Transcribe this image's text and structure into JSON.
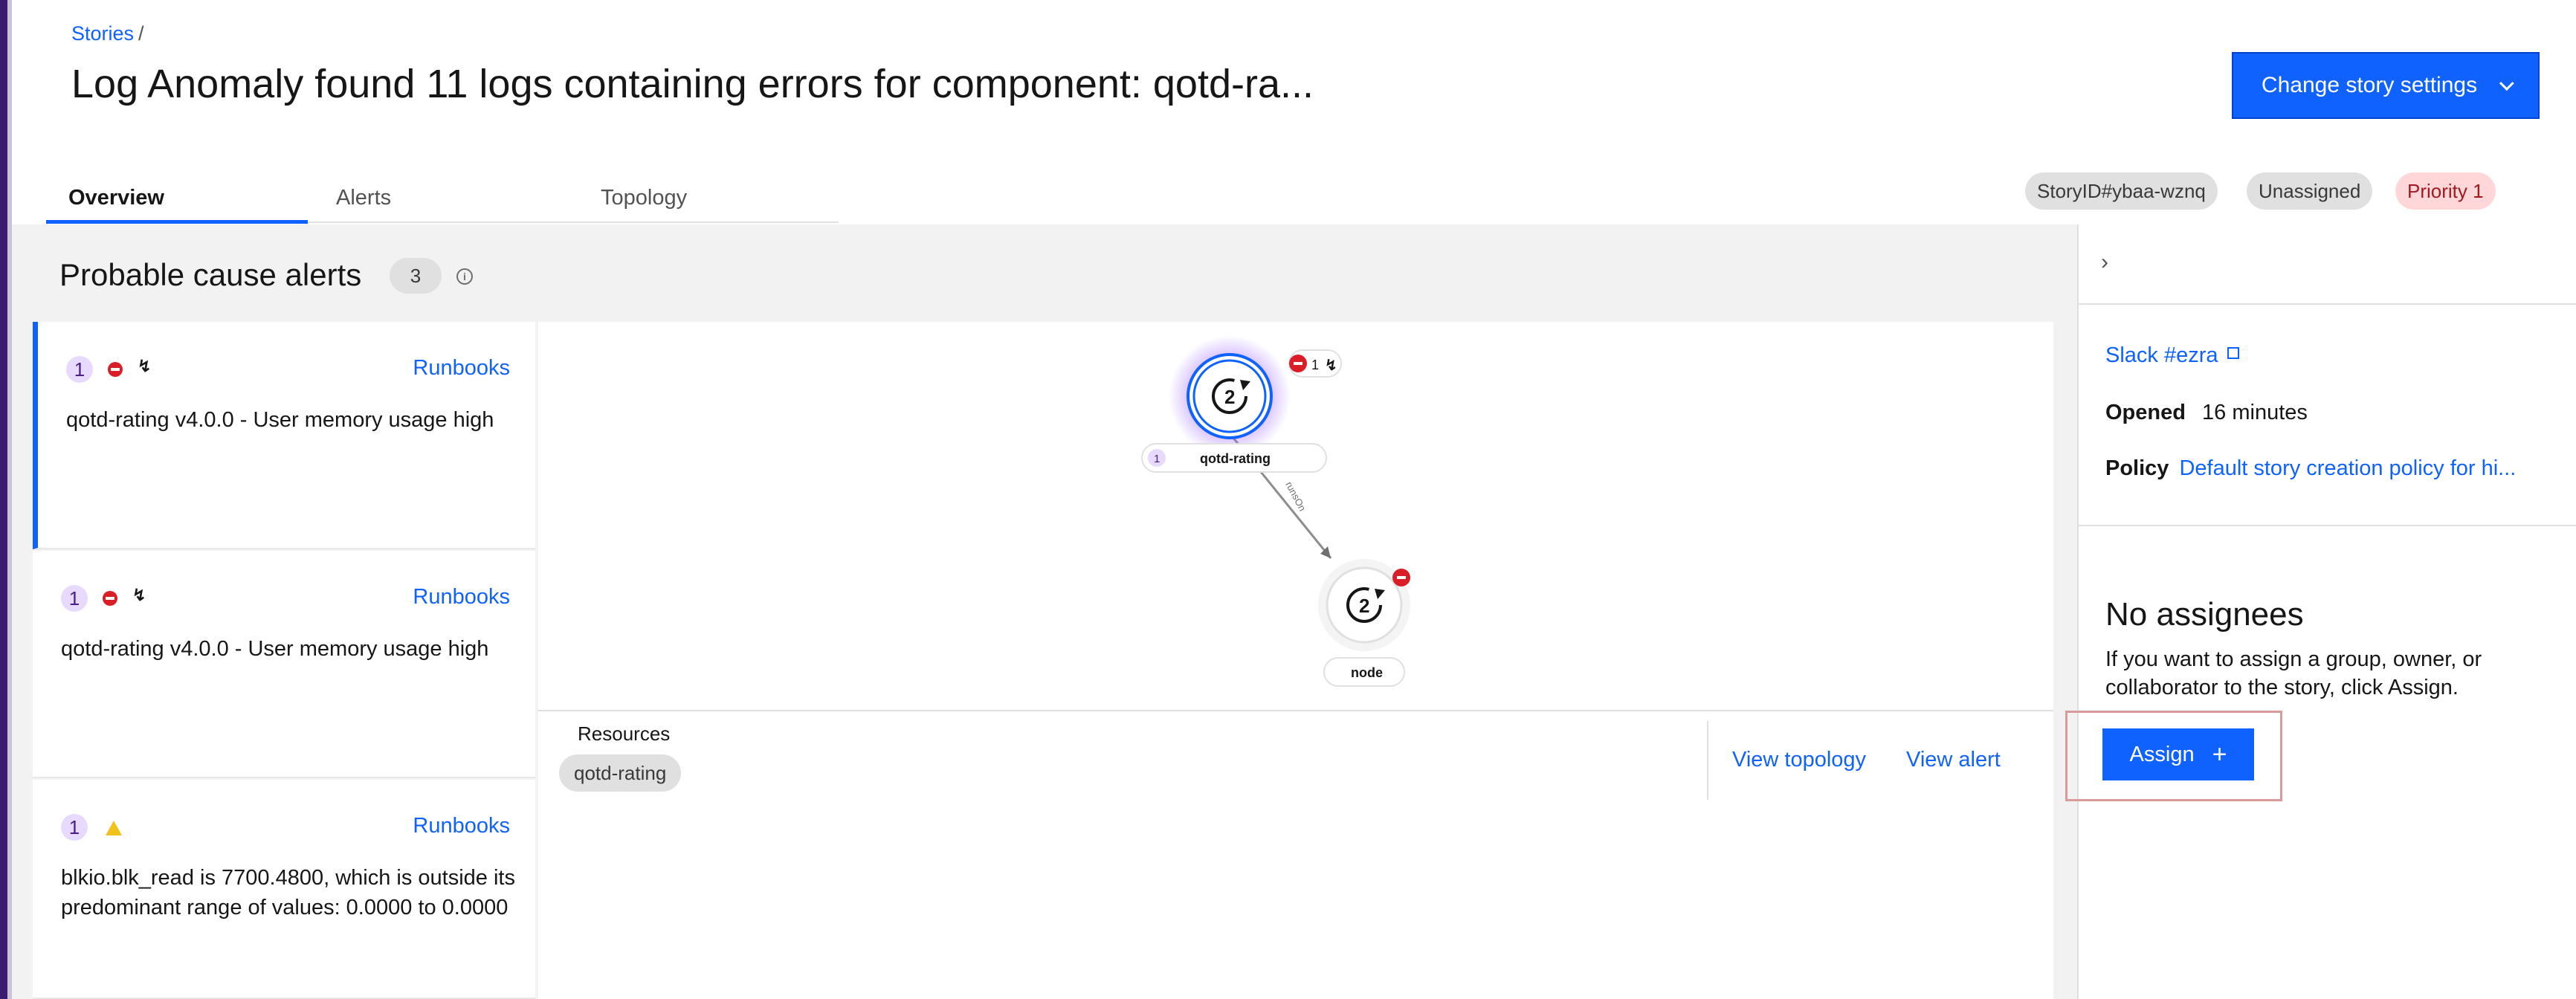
{
  "header": {
    "breadcrumb": "Stories",
    "breadcrumb_sep": "/",
    "title": "Log Anomaly found 11 logs containing errors for component: qotd-ra...",
    "change_settings_label": "Change story settings"
  },
  "tabs": [
    {
      "label": "Overview",
      "active": true
    },
    {
      "label": "Alerts",
      "active": false
    },
    {
      "label": "Topology",
      "active": false
    }
  ],
  "tags": {
    "story_id": "StoryID#ybaa-wznq",
    "assignment": "Unassigned",
    "priority": "Priority 1"
  },
  "probable_cause": {
    "title": "Probable cause alerts",
    "count": "3",
    "alerts": [
      {
        "rank": "1",
        "link": "Runbooks",
        "description": "qotd-rating v4.0.0 - User memory usage high",
        "severity": "critical"
      },
      {
        "rank": "1",
        "link": "Runbooks",
        "description": "qotd-rating v4.0.0 - User memory usage high",
        "severity": "critical"
      },
      {
        "rank": "1",
        "link": "Runbooks",
        "description": "blkio.blk_read is 7700.4800, which is outside its predominant range of values: 0.0000 to 0.0000",
        "severity": "warning"
      }
    ]
  },
  "topology": {
    "nodes": [
      {
        "label": "qotd-rating",
        "badge": "1",
        "count": "1"
      },
      {
        "label": "node"
      }
    ],
    "edge_label": "runsOn"
  },
  "resources": {
    "label": "Resources",
    "items": [
      "qotd-rating"
    ],
    "view_topology": "View topology",
    "view_alert": "View alert"
  },
  "details": {
    "slack": "Slack #ezra",
    "opened_label": "Opened",
    "opened_value": "16 minutes",
    "policy_label": "Policy",
    "policy_value": "Default story creation policy for hi...",
    "no_assignees_title": "No assignees",
    "no_assignees_desc": "If you want to assign a group, owner, or collaborator to the story, click Assign.",
    "assign_label": "Assign"
  },
  "colors": {
    "primary": "#0f62fe",
    "critical": "#da1e28",
    "warning": "#f1c21b",
    "priority_bg": "#ffd7d9"
  }
}
